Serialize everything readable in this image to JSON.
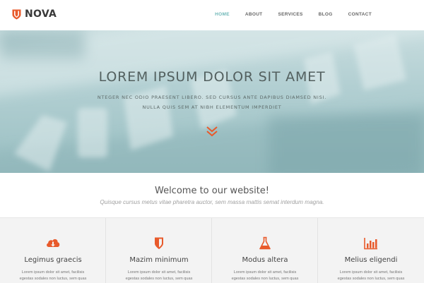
{
  "brand": {
    "name": "NOVA",
    "accent": "#e85a2b"
  },
  "nav": {
    "items": [
      {
        "label": "HOME",
        "active": true
      },
      {
        "label": "ABOUT",
        "active": false
      },
      {
        "label": "SERVICES",
        "active": false
      },
      {
        "label": "BLOG",
        "active": false
      },
      {
        "label": "CONTACT",
        "active": false
      }
    ]
  },
  "hero": {
    "title": "LOREM IPSUM DOLOR SIT AMET",
    "subtitle_line1": "NTEGER NEC ODIO PRAESENT LIBERO. SED CURSUS ANTE DAPIBUS DIAMSED NISI.",
    "subtitle_line2": "NULLA QUIS SEM AT NIBH ELEMENTUM IMPERDIET",
    "scroll_icon": "chevron-double-down-icon"
  },
  "welcome": {
    "title": "Welcome to our website!",
    "subtitle": "Quisque cursus metus vitae pharetra auctor, sem massa mattis semat interdum magna."
  },
  "features": [
    {
      "icon": "cloud-download-icon",
      "title": "Legimus graecis",
      "line1": "Lorem ipsum dolor sit amet, facilisis",
      "line2": "egestas sodales non luctus, sem quas"
    },
    {
      "icon": "shield-icon",
      "title": "Mazim minimum",
      "line1": "Lorem ipsum dolor sit amet, facilisis",
      "line2": "egestas sodales non luctus, sem quas"
    },
    {
      "icon": "flask-icon",
      "title": "Modus altera",
      "line1": "Lorem ipsum dolor sit amet, facilisis",
      "line2": "egestas sodales non luctus, sem quas"
    },
    {
      "icon": "bar-chart-icon",
      "title": "Melius eligendi",
      "line1": "Lorem ipsum dolor sit amet, facilisis",
      "line2": "egestas sodales non luctus, sem quas"
    }
  ]
}
